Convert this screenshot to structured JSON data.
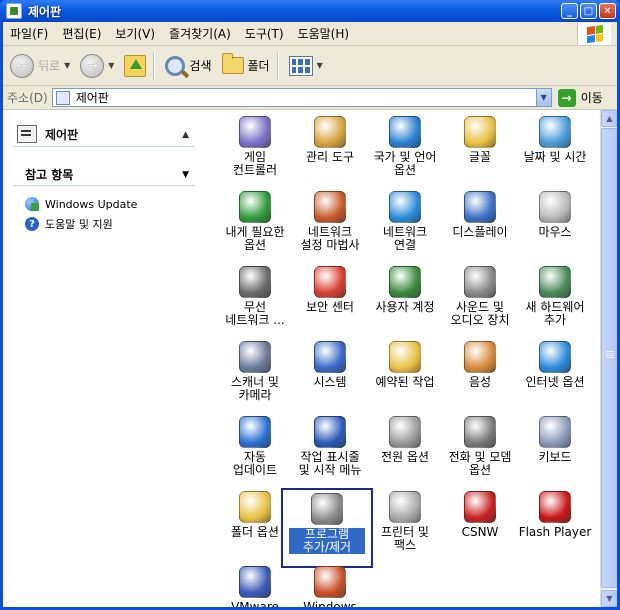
{
  "window": {
    "title": "제어판"
  },
  "menu": [
    "파일(F)",
    "편집(E)",
    "보기(V)",
    "즐겨찾기(A)",
    "도구(T)",
    "도움말(H)"
  ],
  "toolbar": {
    "back_label": "뒤로",
    "search_label": "검색",
    "folders_label": "폴더"
  },
  "address": {
    "label": "주소(D)",
    "value": "제어판",
    "go_label": "이동"
  },
  "left_panel": {
    "control_panel_title": "제어판",
    "see_also_title": "참고 항목",
    "links": [
      {
        "label": "Windows Update",
        "icon": "windows-update-icon"
      },
      {
        "label": "도움말 및 지원",
        "icon": "help-icon"
      }
    ]
  },
  "items": [
    {
      "label": "게임\n컨트롤러",
      "icon": "game-controller-icon",
      "color": "#7b6fc8"
    },
    {
      "label": "관리 도구",
      "icon": "admin-tools-icon",
      "color": "#d9a441"
    },
    {
      "label": "국가 및 언어\n옵션",
      "icon": "globe-icon",
      "color": "#2a7fd0"
    },
    {
      "label": "글꼴",
      "icon": "fonts-folder-icon",
      "color": "#e8c040"
    },
    {
      "label": "날짜 및 시간",
      "icon": "clock-icon",
      "color": "#4a9ad8"
    },
    {
      "label": "내게 필요한\n옵션",
      "icon": "accessibility-icon",
      "color": "#2f9a3a"
    },
    {
      "label": "네트워크\n설정 마법사",
      "icon": "network-house-icon",
      "color": "#c85a2a"
    },
    {
      "label": "네트워크\n연결",
      "icon": "network-globe-icon",
      "color": "#2a8ad8"
    },
    {
      "label": "디스플레이",
      "icon": "display-icon",
      "color": "#3a70c8"
    },
    {
      "label": "마우스",
      "icon": "mouse-icon",
      "color": "#b8b8b8"
    },
    {
      "label": "무선\n네트워크 ...",
      "icon": "wireless-icon",
      "color": "#6a6a6a"
    },
    {
      "label": "보안 센터",
      "icon": "shield-icon",
      "color": "#d84030"
    },
    {
      "label": "사용자 계정",
      "icon": "users-icon",
      "color": "#3a8a3a"
    },
    {
      "label": "사운드 및\n오디오 장치",
      "icon": "speaker-icon",
      "color": "#888888"
    },
    {
      "label": "새 하드웨어\n추가",
      "icon": "hardware-icon",
      "color": "#4a8a5a"
    },
    {
      "label": "스캐너 및\n카메라",
      "icon": "scanner-icon",
      "color": "#6a7a9a"
    },
    {
      "label": "시스템",
      "icon": "system-icon",
      "color": "#3a6ac8"
    },
    {
      "label": "예약된 작업",
      "icon": "scheduled-tasks-icon",
      "color": "#e8c040"
    },
    {
      "label": "음성",
      "icon": "speech-icon",
      "color": "#d88a3a"
    },
    {
      "label": "인터넷 옵션",
      "icon": "internet-options-icon",
      "color": "#2a8ad8"
    },
    {
      "label": "자동\n업데이트",
      "icon": "automatic-updates-icon",
      "color": "#2a70d0"
    },
    {
      "label": "작업 표시줄\n및 시작 메뉴",
      "icon": "taskbar-icon",
      "color": "#2a5ab8"
    },
    {
      "label": "전원 옵션",
      "icon": "power-icon",
      "color": "#9a9a9a"
    },
    {
      "label": "전화 및 모뎀\n옵션",
      "icon": "phone-icon",
      "color": "#7a7a7a"
    },
    {
      "label": "키보드",
      "icon": "keyboard-icon",
      "color": "#8a9ab8"
    },
    {
      "label": "폴더 옵션",
      "icon": "folder-options-icon",
      "color": "#e8c040"
    },
    {
      "label": "프로그램\n추가/제거",
      "icon": "add-remove-programs-icon",
      "color": "#8a8a8a",
      "selected": true
    },
    {
      "label": "프린터 및\n팩스",
      "icon": "printer-icon",
      "color": "#aaaaaa"
    },
    {
      "label": "CSNW",
      "icon": "csnw-icon",
      "color": "#c82020"
    },
    {
      "label": "Flash Player",
      "icon": "flash-player-icon",
      "color": "#c81818"
    },
    {
      "label": "VMware Tools",
      "icon": "vmware-icon",
      "color": "#3a5ab8"
    },
    {
      "label": "Windows",
      "icon": "windows-firewall-icon",
      "color": "#c8502a"
    }
  ]
}
